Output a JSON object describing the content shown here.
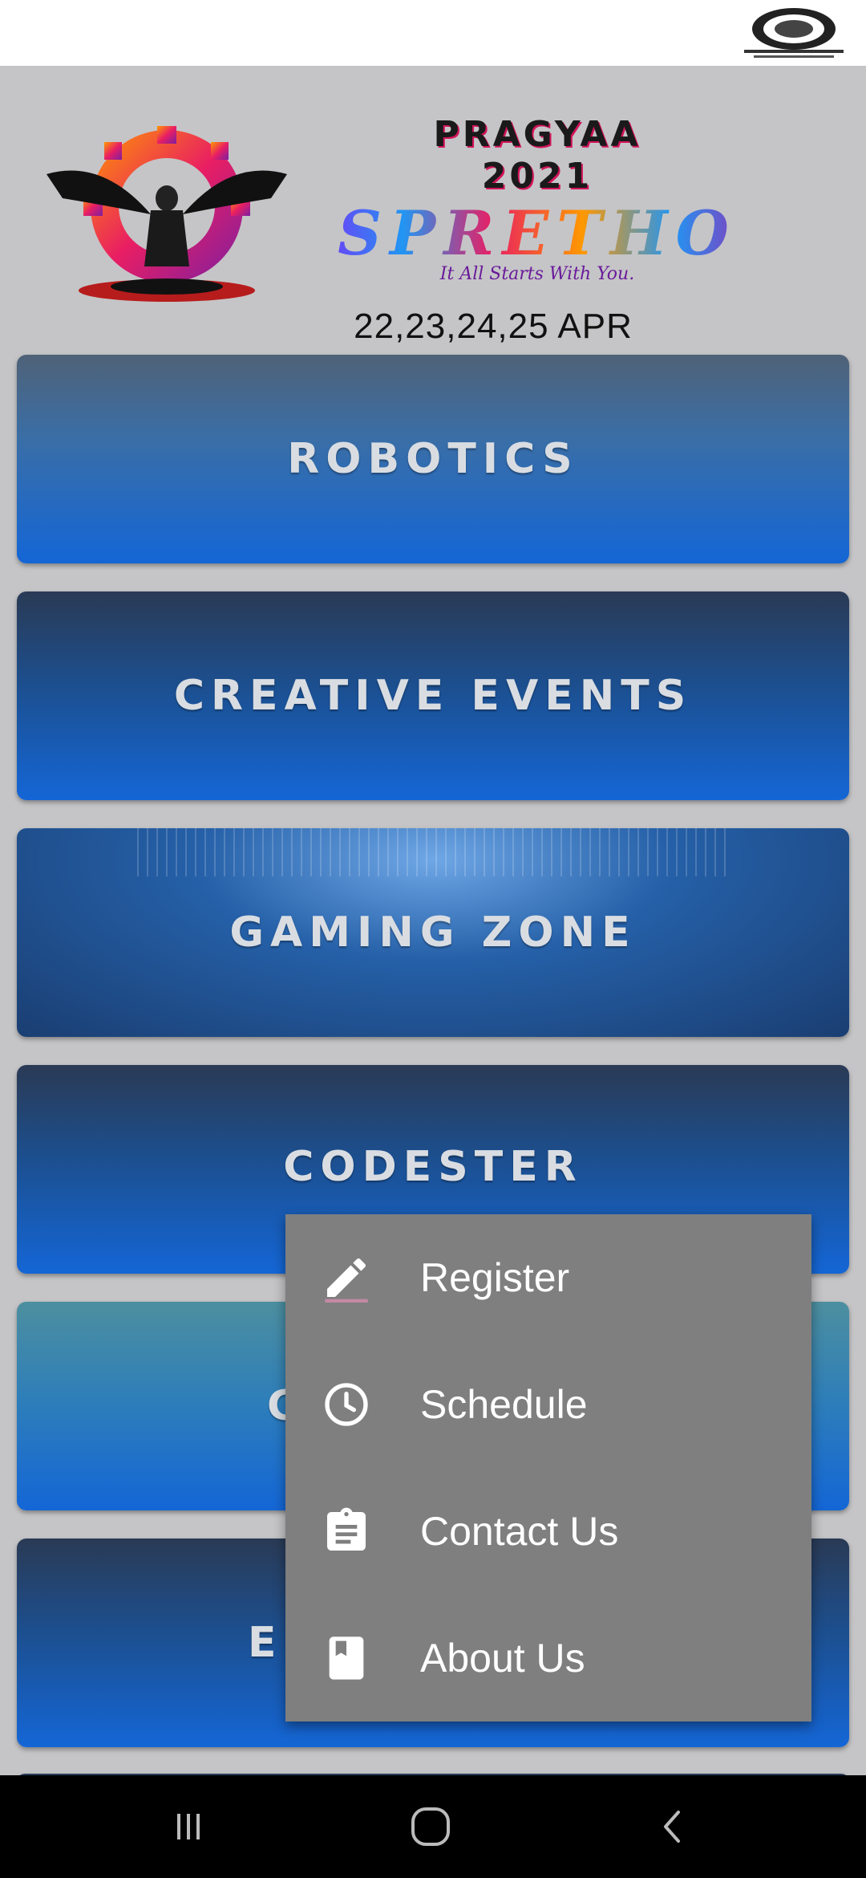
{
  "header": {
    "event_title": "PRAGYAA\n2021",
    "event_name": "SPRETHO",
    "tagline": "It All Starts With You.",
    "dates": "22,23,24,25 APR"
  },
  "categories": [
    {
      "label": "ROBOTICS"
    },
    {
      "label": "CREATIVE EVENTS"
    },
    {
      "label": "GAMING ZONE"
    },
    {
      "label": "CODESTER"
    },
    {
      "label": "C"
    },
    {
      "label": "E"
    }
  ],
  "menu": {
    "items": [
      {
        "label": "Register",
        "icon": "pencil-icon"
      },
      {
        "label": "Schedule",
        "icon": "clock-icon"
      },
      {
        "label": "Contact Us",
        "icon": "clipboard-icon"
      },
      {
        "label": "About Us",
        "icon": "book-icon"
      }
    ]
  },
  "colors": {
    "card_gradient_top": "#2a3a55",
    "card_gradient_bottom": "#1466d6",
    "menu_background": "#7f7f7f",
    "page_background": "#c5c5c7"
  }
}
